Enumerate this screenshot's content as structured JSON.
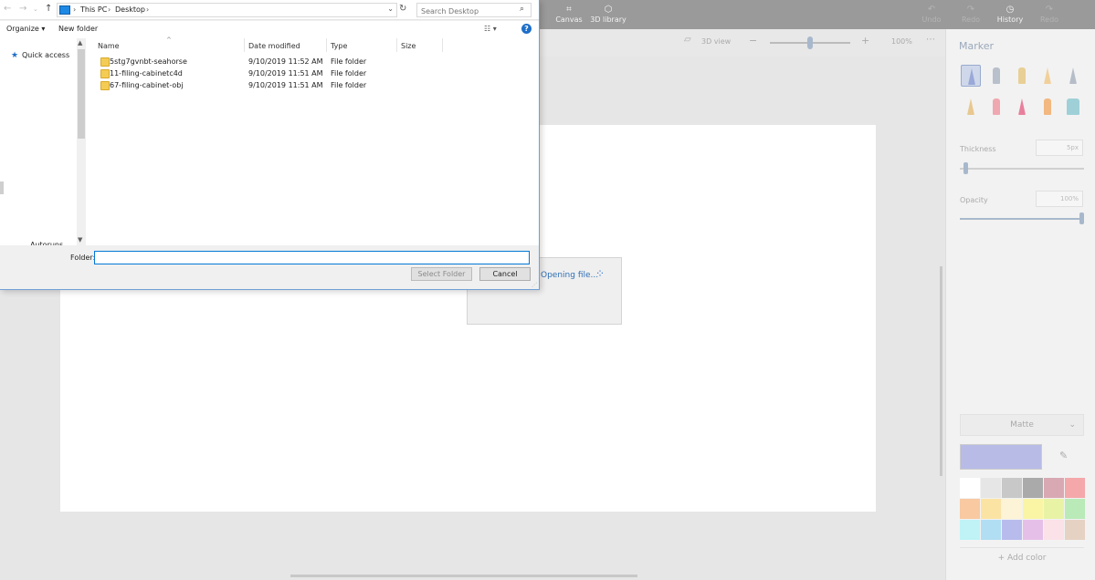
{
  "paint3d": {
    "toolbar": {
      "canvas_label": "Canvas",
      "library_label": "3D library",
      "undo_label": "Undo",
      "redo_label": "Redo",
      "history_label": "History",
      "redo_disabled_label": "Redo"
    },
    "subbar": {
      "view3d_label": "3D view",
      "zoom_value": "100%"
    },
    "loading_text": "Opening file...",
    "panel": {
      "title": "Marker",
      "thickness_label": "Thickness",
      "thickness_value": "5px",
      "opacity_label": "Opacity",
      "opacity_value": "100%",
      "finish_value": "Matte",
      "add_color_label": "Add color",
      "current_color": "#b7bbe6",
      "swatches": [
        "#ffffff",
        "#e6e6e6",
        "#c8c8c8",
        "#aaaaaa",
        "#d9a9b3",
        "#f4a8aa",
        "#f9c9a2",
        "#fbe3a4",
        "#fdf3d6",
        "#f9f5a5",
        "#e8f3a6",
        "#b9eab8",
        "#bff3f6",
        "#b2def3",
        "#b8bcec",
        "#e6bfe8",
        "#fbe1e8",
        "#e6d2c3"
      ]
    }
  },
  "dialog": {
    "breadcrumb": [
      "This PC",
      "Desktop"
    ],
    "search_placeholder": "Search Desktop",
    "organize_label": "Organize",
    "new_folder_label": "New folder",
    "help_label": "?",
    "nav": {
      "quick_access": "Quick access",
      "autoruns": "Autoruns"
    },
    "columns": [
      "Name",
      "Date modified",
      "Type",
      "Size"
    ],
    "files": [
      {
        "name": "5stg7gvnbt-seahorse",
        "date": "9/10/2019 11:52 AM",
        "type": "File folder",
        "size": ""
      },
      {
        "name": "11-filing-cabinetc4d",
        "date": "9/10/2019 11:51 AM",
        "type": "File folder",
        "size": ""
      },
      {
        "name": "67-filing-cabinet-obj",
        "date": "9/10/2019 11:51 AM",
        "type": "File folder",
        "size": ""
      }
    ],
    "folder_label": "Folder:",
    "folder_value": "",
    "select_folder_label": "Select Folder",
    "cancel_label": "Cancel"
  }
}
